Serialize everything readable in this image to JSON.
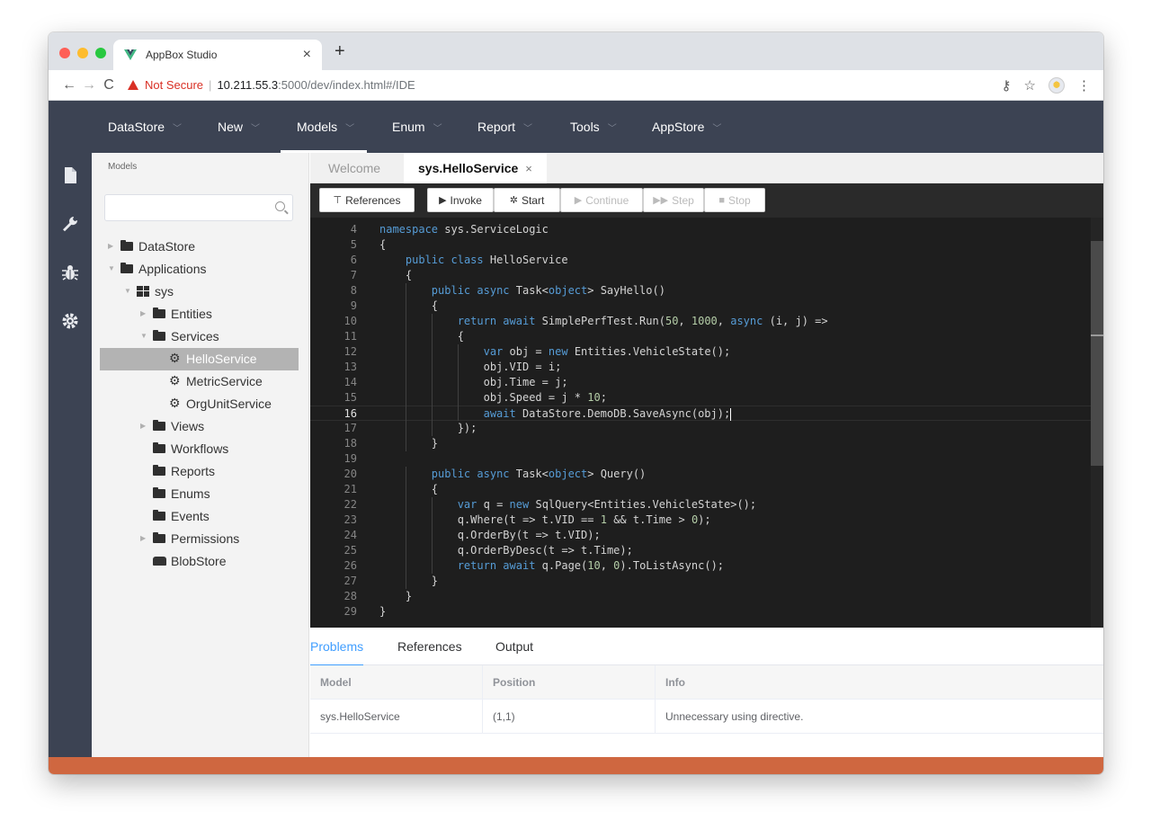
{
  "browser": {
    "tab_title": "AppBox Studio",
    "tab_close": "×",
    "new_tab": "+",
    "url_warning": "Not Secure",
    "url_separator": "|",
    "url_host": "10.211.55.3",
    "url_path": ":5000/dev/index.html#/IDE",
    "traffic_lights": [
      "#fe5f57",
      "#febc2e",
      "#28c840"
    ],
    "vue_logo_colors": [
      "#41b883",
      "#34495e"
    ]
  },
  "topnav": {
    "items": [
      {
        "label": "DataStore"
      },
      {
        "label": "New"
      },
      {
        "label": "Models"
      },
      {
        "label": "Enum"
      },
      {
        "label": "Report"
      },
      {
        "label": "Tools"
      },
      {
        "label": "AppStore"
      }
    ],
    "active": "Models",
    "background": "#3c4353"
  },
  "leftbar": {
    "icons": [
      "file-icon",
      "wrench-icon",
      "bug-icon",
      "gear-icon"
    ]
  },
  "sidebar": {
    "title": "Models",
    "search_placeholder": "",
    "tree": [
      {
        "label": "DataStore",
        "icon": "folder-icon",
        "expandable": true,
        "expanded": false
      },
      {
        "label": "Applications",
        "icon": "folder-icon",
        "expandable": true,
        "expanded": true
      },
      {
        "label": "sys",
        "icon": "app-grid-icon",
        "expandable": true,
        "expanded": true
      },
      {
        "label": "Entities",
        "icon": "folder-icon",
        "expandable": true,
        "expanded": false
      },
      {
        "label": "Services",
        "icon": "folder-icon",
        "expandable": true,
        "expanded": true
      },
      {
        "label": "HelloService",
        "icon": "gear-icon",
        "selected": true
      },
      {
        "label": "MetricService",
        "icon": "gear-icon"
      },
      {
        "label": "OrgUnitService",
        "icon": "gear-icon"
      },
      {
        "label": "Views",
        "icon": "folder-icon",
        "expandable": true,
        "expanded": false
      },
      {
        "label": "Workflows",
        "icon": "folder-icon"
      },
      {
        "label": "Reports",
        "icon": "folder-icon"
      },
      {
        "label": "Enums",
        "icon": "folder-icon"
      },
      {
        "label": "Events",
        "icon": "folder-icon"
      },
      {
        "label": "Permissions",
        "icon": "folder-icon",
        "expandable": true,
        "expanded": false
      },
      {
        "label": "BlobStore",
        "icon": "hdd-icon"
      }
    ]
  },
  "editor": {
    "tabs": [
      {
        "label": "Welcome",
        "active": false
      },
      {
        "label": "sys.HelloService",
        "active": true,
        "close": "×"
      }
    ],
    "toolbar": {
      "references": "References",
      "invoke": "Invoke",
      "start": "Start",
      "continue": "Continue",
      "step": "Step",
      "stop": "Stop"
    },
    "current_line": 16,
    "lines": [
      {
        "n": 4,
        "text": "namespace sys.ServiceLogic"
      },
      {
        "n": 5,
        "text": "{"
      },
      {
        "n": 6,
        "text": "    public class HelloService"
      },
      {
        "n": 7,
        "text": "    {"
      },
      {
        "n": 8,
        "text": "        public async Task<object> SayHello()"
      },
      {
        "n": 9,
        "text": "        {"
      },
      {
        "n": 10,
        "text": "            return await SimplePerfTest.Run(50, 1000, async (i, j) =>"
      },
      {
        "n": 11,
        "text": "            {"
      },
      {
        "n": 12,
        "text": "                var obj = new Entities.VehicleState();"
      },
      {
        "n": 13,
        "text": "                obj.VID = i;"
      },
      {
        "n": 14,
        "text": "                obj.Time = j;"
      },
      {
        "n": 15,
        "text": "                obj.Speed = j * 10;"
      },
      {
        "n": 16,
        "text": "                await DataStore.DemoDB.SaveAsync(obj);"
      },
      {
        "n": 17,
        "text": "            });"
      },
      {
        "n": 18,
        "text": "        }"
      },
      {
        "n": 19,
        "text": ""
      },
      {
        "n": 20,
        "text": "        public async Task<object> Query()"
      },
      {
        "n": 21,
        "text": "        {"
      },
      {
        "n": 22,
        "text": "            var q = new SqlQuery<Entities.VehicleState>();"
      },
      {
        "n": 23,
        "text": "            q.Where(t => t.VID == 1 && t.Time > 0);"
      },
      {
        "n": 24,
        "text": "            q.OrderBy(t => t.VID);"
      },
      {
        "n": 25,
        "text": "            q.OrderByDesc(t => t.Time);"
      },
      {
        "n": 26,
        "text": "            return await q.Page(10, 0).ToListAsync();"
      },
      {
        "n": 27,
        "text": "        }"
      },
      {
        "n": 28,
        "text": "    }"
      },
      {
        "n": 29,
        "text": "}"
      }
    ]
  },
  "panel": {
    "tabs": [
      {
        "label": "Problems",
        "active": true
      },
      {
        "label": "References",
        "active": false
      },
      {
        "label": "Output",
        "active": false
      }
    ],
    "columns": [
      "Model",
      "Position",
      "Info"
    ],
    "rows": [
      [
        "sys.HelloService",
        "(1,1)",
        "Unnecessary using directive."
      ]
    ],
    "accent": "#409eff"
  },
  "footer_color": "#cf6740"
}
